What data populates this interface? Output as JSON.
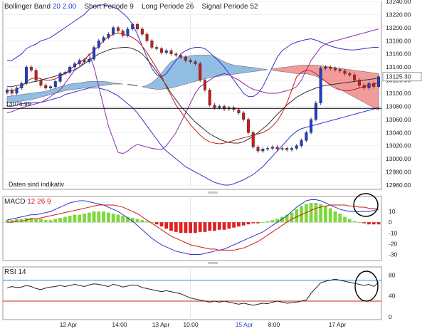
{
  "legend": {
    "bb_name": "Bollinger Band",
    "bb_p1": "20",
    "bb_p2": "2.00",
    "short_label": "Short Periode",
    "short_val": "9",
    "long_label": "Long Periode",
    "long_val": "26",
    "signal_label": "Signal Periode",
    "signal_val": "52"
  },
  "note": "Daten sind indikativ",
  "macd": {
    "name": "MACD",
    "p1": "12",
    "p2": "26",
    "p3": "9"
  },
  "rsi": {
    "name": "RSI",
    "p1": "14"
  },
  "colors": {
    "candle_up": "#1f3fcf",
    "candle_down": "#cc1a1a",
    "cloud_blue": "#7fb3e0",
    "cloud_red": "#f08a8a",
    "histogram_up": "#7fd83a",
    "histogram_down": "#dd2222",
    "ma_black": "#333333",
    "bb_blue": "#3333cc",
    "purple": "#8a2bb0"
  },
  "chart_data": [
    {
      "type": "candlestick",
      "title": "",
      "y_ticks": [
        "13240.00",
        "13220.00",
        "13200.00",
        "13180.00",
        "13160.00",
        "13140.00",
        "13120.00",
        "13100.00",
        "13080.00",
        "13060.00",
        "13040.00",
        "13020.00",
        "13000.00",
        "12980.00",
        "12960.00"
      ],
      "ylim": [
        12960,
        13240
      ],
      "x_ticks": [
        "12 Apr",
        "14:00",
        "13 Apr",
        "10:00",
        "15 Apr",
        "8:00",
        "17 Apr"
      ],
      "reference_line": {
        "label": "13076.99",
        "value": 13076.99
      },
      "last_value": {
        "label": "13125.30",
        "value": 13125.3
      },
      "close": [
        13105,
        13100,
        13108,
        13115,
        13140,
        13135,
        13120,
        13112,
        13108,
        13110,
        13118,
        13130,
        13132,
        13140,
        13145,
        13150,
        13148,
        13152,
        13170,
        13180,
        13185,
        13190,
        13200,
        13195,
        13188,
        13198,
        13205,
        13198,
        13190,
        13180,
        13170,
        13168,
        13162,
        13165,
        13160,
        13158,
        13155,
        13150,
        13148,
        13145,
        13120,
        13105,
        13082,
        13078,
        13080,
        13076,
        13078,
        13075,
        13070,
        13060,
        13040,
        13018,
        13012,
        13015,
        13016,
        13018,
        13015,
        13016,
        13014,
        13016,
        13020,
        13028,
        13040,
        13060,
        13085,
        13138,
        13140,
        13138,
        13136,
        13134,
        13130,
        13128,
        13120,
        13112,
        13108,
        13115,
        13110,
        13125.3
      ],
      "bb_upper": [
        13150,
        13150,
        13155,
        13160,
        13168,
        13172,
        13175,
        13180,
        13182,
        13185,
        13190,
        13195,
        13200,
        13205,
        13210,
        13215,
        13220,
        13228,
        13232,
        13234,
        13235,
        13233,
        13231,
        13228,
        13222,
        13215,
        13205,
        13190,
        13172,
        13155,
        13138,
        13128,
        13125,
        13130,
        13140,
        13150,
        13160,
        13165,
        13168,
        13170,
        13170,
        13168,
        13162,
        13155,
        13148,
        13140,
        13130,
        13120,
        13110,
        13100,
        13095,
        13095,
        13100,
        13110,
        13125,
        13140,
        13155,
        13165,
        13170,
        13175,
        13178,
        13180,
        13182,
        13183,
        13181,
        13178,
        13175,
        13172,
        13170,
        13168,
        13167,
        13166,
        13166,
        13167,
        13168,
        13169,
        13170,
        13170
      ],
      "bb_lower": [
        13080,
        13080,
        13082,
        13084,
        13085,
        13085,
        13086,
        13086,
        13088,
        13090,
        13092,
        13094,
        13098,
        13100,
        13102,
        13104,
        13106,
        13108,
        13108,
        13108,
        13106,
        13104,
        13100,
        13096,
        13090,
        13084,
        13078,
        13070,
        13060,
        13050,
        13040,
        13030,
        13020,
        13012,
        13006,
        13000,
        12994,
        12988,
        12984,
        12980,
        12976,
        12972,
        12968,
        12964,
        12962,
        12960,
        12960,
        12962,
        12965,
        12968,
        12972,
        12976,
        12982,
        12988,
        12996,
        13004,
        13012,
        13020,
        13028,
        13036,
        13042,
        13046,
        13048,
        13050,
        13052,
        13054,
        13056,
        13058,
        13060,
        13062,
        13064,
        13066,
        13068,
        13070,
        13072,
        13074,
        13076,
        13078
      ],
      "ma_black": [
        13110,
        13110,
        13112,
        13113,
        13115,
        13117,
        13118,
        13120,
        13122,
        13124,
        13126,
        13128,
        13130,
        13133,
        13136,
        13140,
        13145,
        13150,
        13155,
        13160,
        13163,
        13166,
        13168,
        13169,
        13170,
        13170,
        13168,
        13165,
        13160,
        13152,
        13143,
        13133,
        13123,
        13112,
        13100,
        13090,
        13080,
        13072,
        13064,
        13056,
        13050,
        13044,
        13038,
        13034,
        13030,
        13027,
        13025,
        13024,
        13024,
        13026,
        13030,
        13034,
        13040,
        13046,
        13052,
        13060,
        13068,
        13075,
        13082,
        13088,
        13094,
        13098,
        13102,
        13105,
        13108,
        13110,
        13112,
        13113,
        13114,
        13115,
        13116,
        13117,
        13118,
        13119,
        13120,
        13121,
        13122,
        13123
      ],
      "ma_red": [
        13105,
        13104,
        13106,
        13110,
        13118,
        13122,
        13124,
        13122,
        13120,
        13120,
        13122,
        13126,
        13130,
        13136,
        13142,
        13147,
        13152,
        13158,
        13165,
        13172,
        13180,
        13186,
        13190,
        13192,
        13190,
        13188,
        13185,
        13180,
        13172,
        13162,
        13150,
        13138,
        13126,
        13110,
        13096,
        13082,
        13072,
        13062,
        13052,
        13044,
        13036,
        13030,
        13026,
        13024,
        13023,
        13024,
        13026,
        13028,
        13030,
        13032,
        13034,
        13036,
        13038,
        13040,
        13044,
        13050,
        13058,
        13070,
        13085,
        13105,
        13125,
        13132,
        13135,
        13134,
        13130,
        13124,
        13118,
        13112,
        13108,
        13105,
        13104,
        13104,
        13106,
        13108,
        13110,
        13112,
        13114,
        13116
      ],
      "purple": [
        13070,
        13072,
        13075,
        13078,
        13080,
        13082,
        13084,
        13086,
        13090,
        13095,
        13100,
        13105,
        13115,
        13125,
        13135,
        13140,
        13148,
        13160,
        13140,
        13110,
        13080,
        13050,
        13030,
        13010,
        13008,
        13012,
        13018,
        13022,
        13020,
        13018,
        13016,
        13015,
        13014,
        13020,
        13030,
        13040,
        13055,
        13070,
        13085,
        13100,
        13110,
        13115,
        13120,
        13125,
        13128,
        13130,
        13128,
        13124,
        13120,
        13115,
        13110,
        13106,
        13104,
        13102,
        13100,
        13100,
        13100,
        13102,
        13104,
        13106,
        13110,
        13120,
        13135,
        13150,
        13160,
        13170,
        13175,
        13178,
        13180,
        13182,
        13184,
        13186,
        13188,
        13190,
        13192,
        13194,
        13196,
        13198
      ],
      "cloud_a": [
        13095,
        13096,
        13097,
        13098,
        13099,
        13100,
        13101,
        13102,
        13103,
        13105,
        13108,
        13110,
        13112,
        13114,
        13115,
        13116,
        13117,
        13118,
        13118,
        13118,
        13118,
        13117,
        13116,
        13115,
        13114,
        13113,
        13112,
        13111,
        13110,
        13112,
        13116,
        13122,
        13130,
        13140,
        13148,
        13152,
        13155,
        13156,
        13157,
        13158,
        13158,
        13158,
        13158,
        13156,
        13152,
        13148,
        13145,
        13143,
        13142,
        13141,
        13140,
        13139,
        13138,
        13137,
        13136,
        13135,
        13134,
        13133,
        13132,
        13131,
        13130,
        13130,
        13130,
        13128,
        13126,
        13122,
        13118,
        13114,
        13110,
        13106,
        13102,
        13098,
        13094,
        13090,
        13086,
        13082,
        13078,
        13074
      ],
      "cloud_b": [
        13085,
        13086,
        13087,
        13088,
        13089,
        13090,
        13092,
        13094,
        13096,
        13098,
        13100,
        13102,
        13104,
        13105,
        13106,
        13107,
        13108,
        13109,
        13110,
        13111,
        13112,
        13113,
        13114,
        13114,
        13114,
        13114,
        13113,
        13112,
        13110,
        13108,
        13107,
        13106,
        13106,
        13107,
        13108,
        13110,
        13112,
        13114,
        13116,
        13118,
        13120,
        13122,
        13124,
        13125,
        13126,
        13127,
        13128,
        13129,
        13130,
        13131,
        13132,
        13133,
        13134,
        13135,
        13136,
        13137,
        13138,
        13139,
        13140,
        13141,
        13142,
        13143,
        13143,
        13143,
        13143,
        13142,
        13141,
        13140,
        13139,
        13138,
        13137,
        13136,
        13135,
        13134,
        13133,
        13132,
        13131,
        13130
      ]
    },
    {
      "type": "bar",
      "title": "MACD",
      "y_ticks": [
        "10",
        "0",
        "-10",
        "-20",
        "-30"
      ],
      "ylim": [
        -33,
        20
      ],
      "histogram": [
        2,
        2,
        3,
        3,
        4,
        4,
        3,
        3,
        2,
        2,
        3,
        4,
        5,
        6,
        7,
        7,
        8,
        9,
        10,
        10,
        10,
        9,
        8,
        7,
        6,
        5,
        4,
        3,
        2,
        1,
        0,
        -2,
        -4,
        -6,
        -8,
        -9,
        -10,
        -10,
        -10,
        -10,
        -9,
        -9,
        -8,
        -8,
        -7,
        -7,
        -6,
        -5,
        -4,
        -3,
        -2,
        -1,
        -1,
        0,
        1,
        2,
        3,
        5,
        7,
        9,
        12,
        15,
        17,
        18,
        18,
        17,
        15,
        13,
        10,
        8,
        5,
        3,
        1,
        0,
        -1,
        -2,
        -2,
        -2
      ],
      "macd_line": [
        2,
        3,
        4,
        5,
        6,
        7,
        7,
        8,
        9,
        10,
        12,
        14,
        16,
        18,
        19,
        20,
        20,
        19,
        18,
        17,
        16,
        14,
        12,
        10,
        7,
        4,
        1,
        -3,
        -7,
        -11,
        -15,
        -18,
        -21,
        -23,
        -25,
        -27,
        -28,
        -29,
        -30,
        -30,
        -30,
        -29,
        -28,
        -27,
        -26,
        -25,
        -23,
        -21,
        -19,
        -17,
        -15,
        -13,
        -11,
        -9,
        -6,
        -3,
        0,
        3,
        6,
        10,
        14,
        17,
        20,
        21,
        21,
        20,
        18,
        16,
        14,
        12,
        11,
        10,
        10,
        10,
        10,
        10,
        11,
        12
      ],
      "signal_line": [
        0,
        0,
        1,
        1,
        2,
        3,
        3,
        4,
        5,
        6,
        7,
        8,
        9,
        10,
        11,
        12,
        13,
        14,
        15,
        16,
        16,
        16,
        16,
        15,
        14,
        12,
        10,
        8,
        5,
        2,
        -1,
        -4,
        -7,
        -10,
        -13,
        -15,
        -17,
        -19,
        -21,
        -22,
        -23,
        -24,
        -25,
        -25,
        -26,
        -26,
        -26,
        -26,
        -25,
        -24,
        -22,
        -20,
        -18,
        -15,
        -12,
        -9,
        -6,
        -3,
        0,
        3,
        5,
        7,
        9,
        11,
        13,
        14,
        15,
        16,
        16,
        16,
        16,
        15,
        15,
        14,
        14,
        13,
        13,
        12
      ]
    },
    {
      "type": "line",
      "title": "RSI",
      "y_ticks": [
        "80",
        "40",
        "0"
      ],
      "ylim": [
        0,
        90
      ],
      "upper_band": 70,
      "lower_band": 30,
      "values": [
        55,
        58,
        56,
        57,
        60,
        58,
        54,
        52,
        55,
        57,
        58,
        60,
        58,
        60,
        62,
        60,
        58,
        61,
        63,
        62,
        60,
        58,
        62,
        60,
        57,
        59,
        61,
        60,
        56,
        54,
        52,
        50,
        48,
        50,
        48,
        46,
        44,
        40,
        36,
        34,
        32,
        30,
        28,
        30,
        28,
        30,
        28,
        26,
        24,
        26,
        24,
        22,
        24,
        26,
        25,
        28,
        30,
        28,
        26,
        27,
        28,
        30,
        32,
        45,
        55,
        65,
        68,
        70,
        72,
        70,
        68,
        66,
        64,
        62,
        60,
        62,
        58,
        66
      ]
    }
  ]
}
